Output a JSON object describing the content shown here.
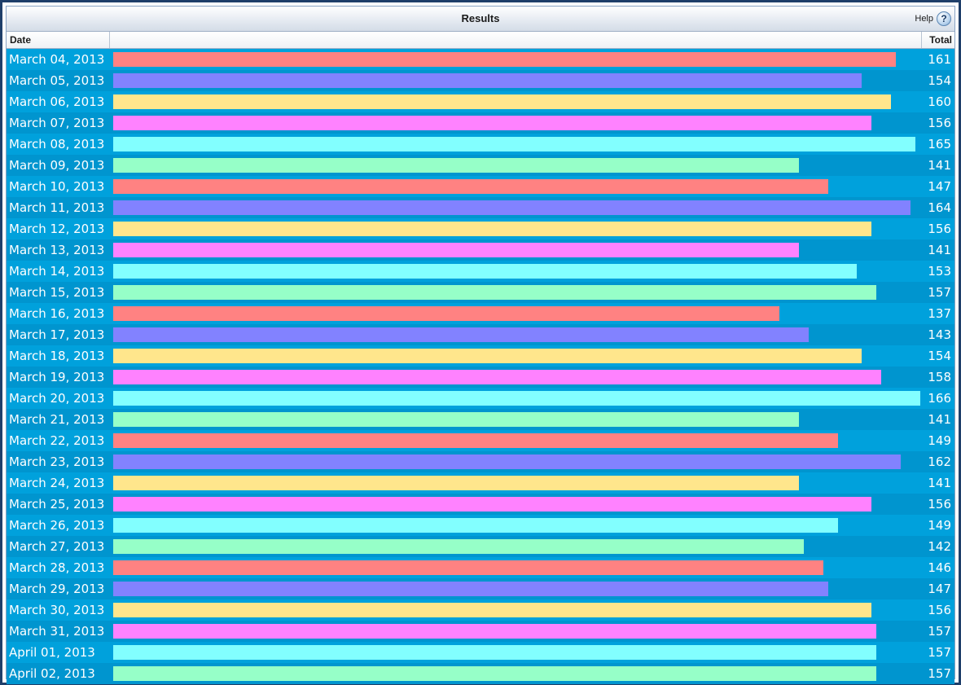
{
  "window": {
    "title": "Results",
    "help_label": "Help",
    "help_icon": "help-icon"
  },
  "header": {
    "date": "Date",
    "total": "Total"
  },
  "colors": {
    "row_odd": "#00a1dc",
    "row_even": "#0095cf",
    "palette": [
      "#ff8282",
      "#8282ff",
      "#ffe68c",
      "#ff82ff",
      "#82ffff",
      "#96ffc8"
    ]
  },
  "chart_data": {
    "type": "bar",
    "orientation": "horizontal",
    "xlim": [
      0,
      166
    ],
    "categories": [
      "March 04, 2013",
      "March 05, 2013",
      "March 06, 2013",
      "March 07, 2013",
      "March 08, 2013",
      "March 09, 2013",
      "March 10, 2013",
      "March 11, 2013",
      "March 12, 2013",
      "March 13, 2013",
      "March 14, 2013",
      "March 15, 2013",
      "March 16, 2013",
      "March 17, 2013",
      "March 18, 2013",
      "March 19, 2013",
      "March 20, 2013",
      "March 21, 2013",
      "March 22, 2013",
      "March 23, 2013",
      "March 24, 2013",
      "March 25, 2013",
      "March 26, 2013",
      "March 27, 2013",
      "March 28, 2013",
      "March 29, 2013",
      "March 30, 2013",
      "March 31, 2013",
      "April 01, 2013",
      "April 02, 2013"
    ],
    "values": [
      161,
      154,
      160,
      156,
      165,
      141,
      147,
      164,
      156,
      141,
      153,
      157,
      137,
      143,
      154,
      158,
      166,
      141,
      149,
      162,
      141,
      156,
      149,
      142,
      146,
      147,
      156,
      157,
      157,
      157
    ]
  }
}
